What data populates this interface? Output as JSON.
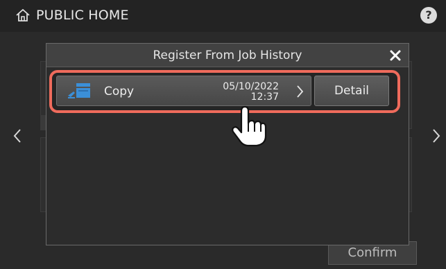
{
  "header": {
    "home_icon": "home-icon",
    "title": "PUBLIC HOME",
    "help_icon": "help-icon",
    "help_glyph": "?"
  },
  "navigation": {
    "left_icon": "chevron-left-icon",
    "right_icon": "chevron-right-icon"
  },
  "footer": {
    "confirm_label": "Confirm"
  },
  "dialog": {
    "title": "Register From Job History",
    "close_icon": "close-icon",
    "jobs": [
      {
        "icon": "copy-icon",
        "type": "Copy",
        "date": "05/10/2022",
        "time": "12:37",
        "detail_label": "Detail"
      }
    ]
  },
  "colors": {
    "highlight": "#ef6b5c",
    "dialog_header": "#424242",
    "icon_blue": "#3b8fd8"
  }
}
